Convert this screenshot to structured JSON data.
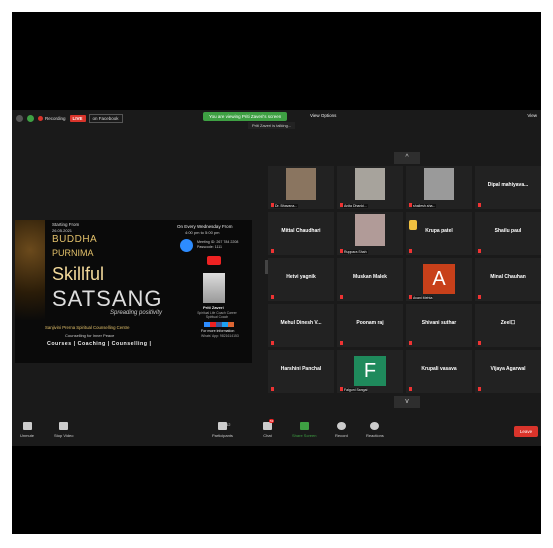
{
  "topbar": {
    "recording": "Recording",
    "live": "LIVE",
    "live_on": "on Facebook",
    "banner": "You are viewing Priti Zaveri's screen",
    "view_options": "View Options",
    "view": "View",
    "speaking": "Priti Zaveri is talking..."
  },
  "share": {
    "starting_from": "Starting From",
    "date": "26.05.2021",
    "title1": "BUDDHA",
    "title2": "PURNIMA",
    "skillful": "Skillful",
    "satsang": "SATSANG",
    "tagline": "Spreading positivity",
    "center": "Sanjivini Prerna Spiritual Counselling Centre",
    "sub": "Counselling for Inner Peace",
    "services": "Courses | Coaching | Counselling |",
    "every_wed": "On Every Wednesday From",
    "time": "4:00 pm to 5:00 pm",
    "meeting": "Meeting ID: 267 784 2208 Passcode: 1111",
    "host_name": "Priti Zaveri",
    "host_desc": "Spiritual Life Coach Career Spiritual Coach",
    "more_info": "For more information",
    "contact": "Whats' App: 9821614153"
  },
  "participants": [
    {
      "name": "Dr. Bhavana...",
      "kind": "video",
      "color": "#8a7560"
    },
    {
      "name": "Anita Dhanki...",
      "kind": "video",
      "color": "#a7a39c"
    },
    {
      "name": "shailesh.sha...",
      "kind": "video",
      "color": "#9a9a9a"
    },
    {
      "name": "Dipal mahiyava...",
      "kind": "name"
    },
    {
      "name": "Mittal Chaudhari",
      "kind": "name"
    },
    {
      "name": "Ruppara Shah",
      "kind": "video",
      "color": "#b19b98"
    },
    {
      "name": "Krupa patel",
      "kind": "name-hand"
    },
    {
      "name": "Shailu paul",
      "kind": "name"
    },
    {
      "name": "Hetvi yagnik",
      "kind": "name"
    },
    {
      "name": "Muskan Malek",
      "kind": "name"
    },
    {
      "name": "Avani Mehta",
      "kind": "avatar",
      "letter": "A",
      "color": "#c8401a"
    },
    {
      "name": "Minal Chauhan",
      "kind": "name"
    },
    {
      "name": "Mehul Dinesh V...",
      "kind": "name"
    },
    {
      "name": "Poonam raj",
      "kind": "name"
    },
    {
      "name": "Shivani suthar",
      "kind": "name"
    },
    {
      "name": "Zeel☐",
      "kind": "name"
    },
    {
      "name": "Harshini Panchal",
      "kind": "name"
    },
    {
      "name": "Falguni Sangal",
      "kind": "avatar",
      "letter": "F",
      "color": "#1f8a5c"
    },
    {
      "name": "Krupali vasava",
      "kind": "name"
    },
    {
      "name": "Vijaya Agarwal",
      "kind": "name"
    }
  ],
  "controls": {
    "unmute": "Unmute",
    "stop_video": "Stop Video",
    "participants": "Participants",
    "participant_count": "62",
    "chat": "Chat",
    "chat_badge": "53",
    "share_screen": "Share Screen",
    "record": "Record",
    "reactions": "Reactions",
    "leave": "Leave"
  },
  "nav": {
    "up": "^",
    "down": "v"
  }
}
